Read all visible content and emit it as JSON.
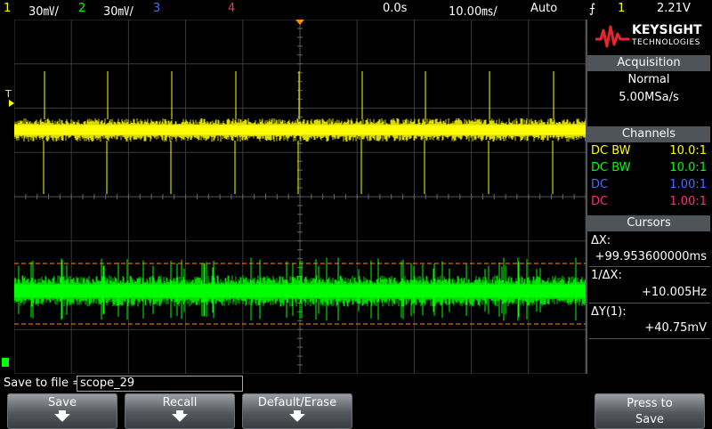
{
  "status": {
    "ch1_num": "1",
    "ch1_scale": "30㎷/",
    "ch2_num": "2",
    "ch2_scale": "30㎷/",
    "ch3_num": "3",
    "ch4_num": "4",
    "delay": "0.0s",
    "timebase": "10.00㎳/",
    "trigger_mode": "Auto",
    "trigger_source": "1",
    "trigger_level": "2.21V"
  },
  "brand": {
    "name": "KEYSIGHT",
    "subtitle": "TECHNOLOGIES"
  },
  "acquisition": {
    "header": "Acquisition",
    "mode": "Normal",
    "rate": "5.00MSa/s"
  },
  "channels": {
    "header": "Channels",
    "rows": [
      {
        "coupling": "DC BW",
        "probe": "10.0:1",
        "color": "#ffff00"
      },
      {
        "coupling": "DC BW",
        "probe": "10.0:1",
        "color": "#00ff00"
      },
      {
        "coupling": "DC",
        "probe": "1.00:1",
        "color": "#4a6cff"
      },
      {
        "coupling": "DC",
        "probe": "1.00:1",
        "color": "#ff2a7a"
      }
    ]
  },
  "cursors": {
    "header": "Cursors",
    "dx_label": "ΔX:",
    "dx_value": "+99.953600000ms",
    "inv_label": "1/ΔX:",
    "inv_value": "+10.005Hz",
    "dy_label": "ΔY(1):",
    "dy_value": "+40.75mV"
  },
  "markers": {
    "trigger_mark": "T"
  },
  "save": {
    "label": "Save to file =",
    "filename": "scope_29"
  },
  "softkeys": {
    "save": "Save",
    "recall": "Recall",
    "default_erase": "Default/Erase",
    "press_to_save": "Press to\nSave"
  },
  "colors": {
    "ch1": "#ffff00",
    "ch2": "#00ff00",
    "ch3": "#4a6cff",
    "ch4": "#ff2a7a",
    "cursor": "#ff8c00",
    "header": "#4f5458"
  }
}
